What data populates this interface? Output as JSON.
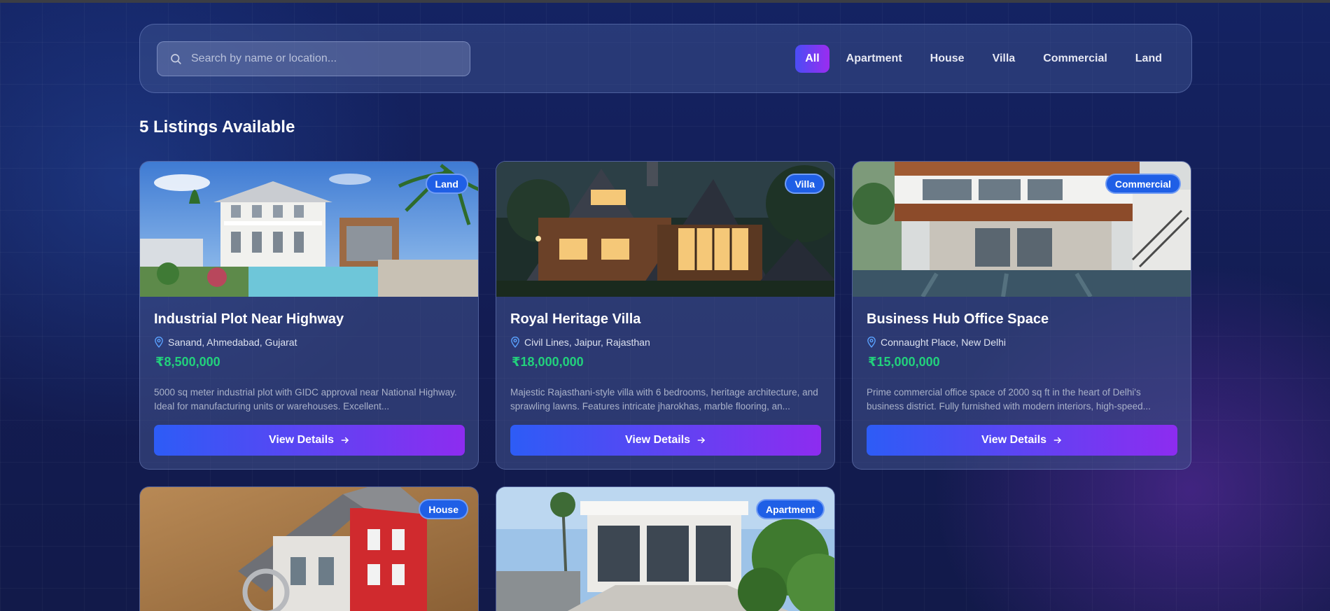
{
  "search": {
    "placeholder": "Search by name or location..."
  },
  "filters": [
    {
      "label": "All",
      "active": true
    },
    {
      "label": "Apartment",
      "active": false
    },
    {
      "label": "House",
      "active": false
    },
    {
      "label": "Villa",
      "active": false
    },
    {
      "label": "Commercial",
      "active": false
    },
    {
      "label": "Land",
      "active": false
    }
  ],
  "listings_count": "5 Listings Available",
  "currency_symbol": "₹",
  "view_label": "View Details",
  "listings": [
    {
      "badge": "Land",
      "title": "Industrial Plot Near Highway",
      "location": "Sanand, Ahmedabad, Gujarat",
      "price": "8,500,000",
      "description": "5000 sq meter industrial plot with GIDC approval near National Highway. Ideal for manufacturing units or warehouses. Excellent..."
    },
    {
      "badge": "Villa",
      "title": "Royal Heritage Villa",
      "location": "Civil Lines, Jaipur, Rajasthan",
      "price": "18,000,000",
      "description": "Majestic Rajasthani-style villa with 6 bedrooms, heritage architecture, and sprawling lawns. Features intricate jharokhas, marble flooring, an..."
    },
    {
      "badge": "Commercial",
      "title": "Business Hub Office Space",
      "location": "Connaught Place, New Delhi",
      "price": "15,000,000",
      "description": "Prime commercial office space of 2000 sq ft in the heart of Delhi's business district. Fully furnished with modern interiors, high-speed..."
    },
    {
      "badge": "House"
    },
    {
      "badge": "Apartment"
    }
  ],
  "colors": {
    "accent_start": "#2d5cf6",
    "accent_end": "#8d2cf0",
    "price": "#22d17c",
    "badge": "#1f5fe6"
  }
}
